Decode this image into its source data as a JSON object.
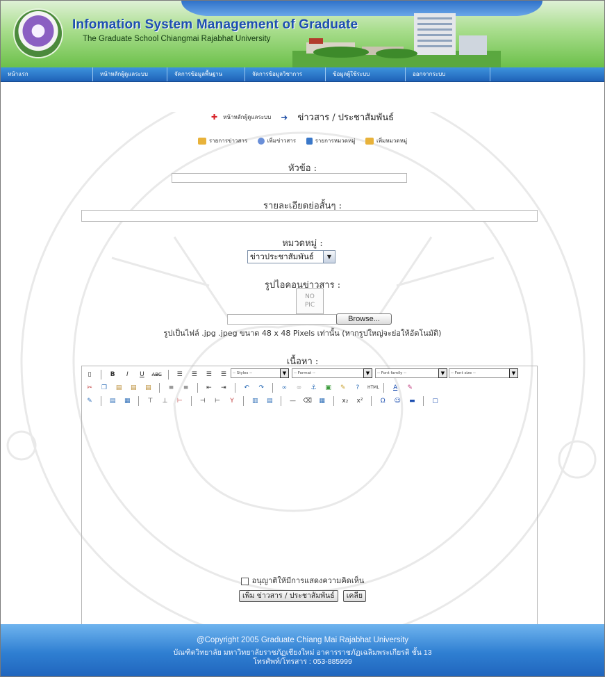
{
  "header": {
    "title": "Infomation System Management of Graduate",
    "subtitle": "The Graduate School Chiangmai Rajabhat University"
  },
  "nav": [
    {
      "label": "หน้าแรก"
    },
    {
      "label": "หน้าหลักผู้ดูแลระบบ"
    },
    {
      "label": "จัดการข้อมูลพื้นฐาน"
    },
    {
      "label": "จัดการข้อมูลวิชาการ"
    },
    {
      "label": "ข้อมูลผู้ใช้ระบบ"
    },
    {
      "label": "ออกจากระบบ"
    }
  ],
  "breadcrumb": {
    "home": "หน้าหลักผู้ดูแลระบบ",
    "current": "ข่าวสาร / ประชาสัมพันธ์"
  },
  "actions": [
    {
      "label": "รายการข่าวสาร",
      "icon": "folder-icon",
      "color": "#e8b23a"
    },
    {
      "label": "เพิ่มข่าวสาร",
      "icon": "refresh-icon",
      "color": "#6a8fd8"
    },
    {
      "label": "รายการหมวดหมู่",
      "icon": "bin-icon",
      "color": "#3a78c9"
    },
    {
      "label": "เพิ่มหมวดหมู่",
      "icon": "folder-add-icon",
      "color": "#e8b23a"
    }
  ],
  "form": {
    "subject_label": "หัวข้อ :",
    "subject_value": "",
    "summary_label": "รายละเอียดย่อสั้นๆ :",
    "summary_value": "",
    "category_label": "หมวดหมู่ :",
    "category_value": "ข่าวประชาสัมพันธ์",
    "icon_label": "รูปไอคอนข่าวสาร :",
    "nopic_line1": "NO",
    "nopic_line2": "PIC",
    "browse_label": "Browse...",
    "icon_hint": "รูปเป็นไฟล์ .jpg .jpeg ขนาด 48 x 48 Pixels เท่านั้น (หากรูปใหญ่จะย่อให้อัตโนมัติ)",
    "content_label": "เนื้อหา :",
    "allow_comments_label": "อนุญาติให้มีการแสดงความคิดเห็น",
    "submit_label": "เพิ่ม ข่าวสาร / ประชาสัมพันธ์",
    "reset_label": "เคลีย"
  },
  "editor": {
    "styles_placeholder": "-- Styles --",
    "format_placeholder": "-- Format --",
    "font_family_placeholder": "-- Font family --",
    "font_size_placeholder": "-- Font size --"
  },
  "footer": {
    "line1": "@Copyright 2005 Graduate Chiang Mai Rajabhat University",
    "line2": "บัณฑิตวิทยาลัย มหาวิทยาลัยราชภัฏเชียงใหม่ อาคารราชภัฏเฉลิมพระเกียรติ ชั้น 13",
    "line3": "โทรศัพท์/โทรสาร : 053-885999"
  },
  "colors": {
    "nav_bg": "#2b78c9",
    "header_green": "#6cc04a",
    "title_blue": "#1d4fb0",
    "footer_blue": "#2f7fd2",
    "breadcrumb_marker": "#d8232a"
  }
}
